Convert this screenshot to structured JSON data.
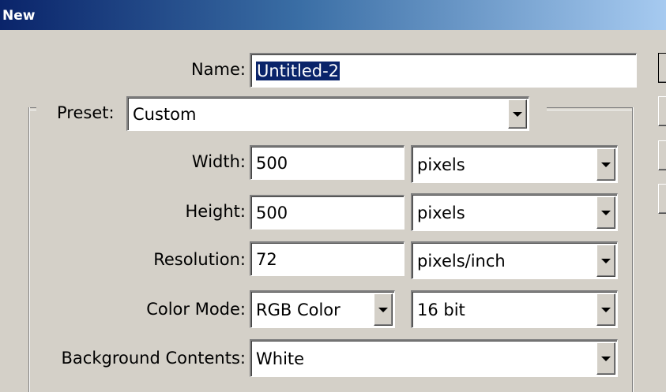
{
  "window": {
    "title": "New"
  },
  "name": {
    "label": "Name:",
    "value": "Untitled-2"
  },
  "preset": {
    "label": "Preset:",
    "value": "Custom"
  },
  "width": {
    "label": "Width:",
    "value": "500",
    "unit": "pixels"
  },
  "height": {
    "label": "Height:",
    "value": "500",
    "unit": "pixels"
  },
  "resolution": {
    "label": "Resolution:",
    "value": "72",
    "unit": "pixels/inch"
  },
  "color_mode": {
    "label": "Color Mode:",
    "value": "RGB Color",
    "depth": "16 bit"
  },
  "background": {
    "label": "Background Contents:",
    "value": "White"
  },
  "icons": {
    "dropdown": "chevron-down-icon"
  }
}
